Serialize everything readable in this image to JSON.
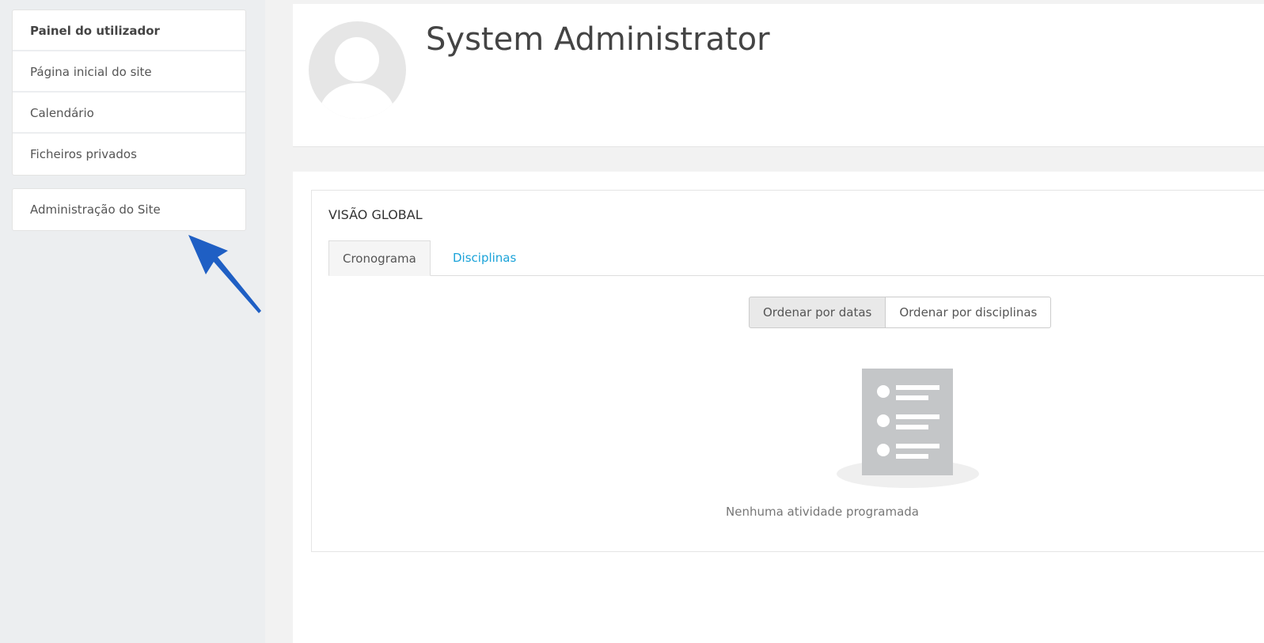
{
  "sidebar": {
    "items": [
      {
        "label": "Painel do utilizador"
      },
      {
        "label": "Página inicial do site"
      },
      {
        "label": "Calendário"
      },
      {
        "label": "Ficheiros privados"
      }
    ],
    "admin": {
      "label": "Administração do Site"
    }
  },
  "header": {
    "name": "System Administrator"
  },
  "overview": {
    "title": "VISÃO GLOBAL",
    "tabs": [
      {
        "label": "Cronograma"
      },
      {
        "label": "Disciplinas"
      }
    ],
    "sort": [
      {
        "label": "Ordenar por datas"
      },
      {
        "label": "Ordenar por disciplinas"
      }
    ],
    "empty": "Nenhuma atividade programada"
  },
  "colors": {
    "accent": "#1ba3d9",
    "arrow": "#1f5fc4"
  }
}
